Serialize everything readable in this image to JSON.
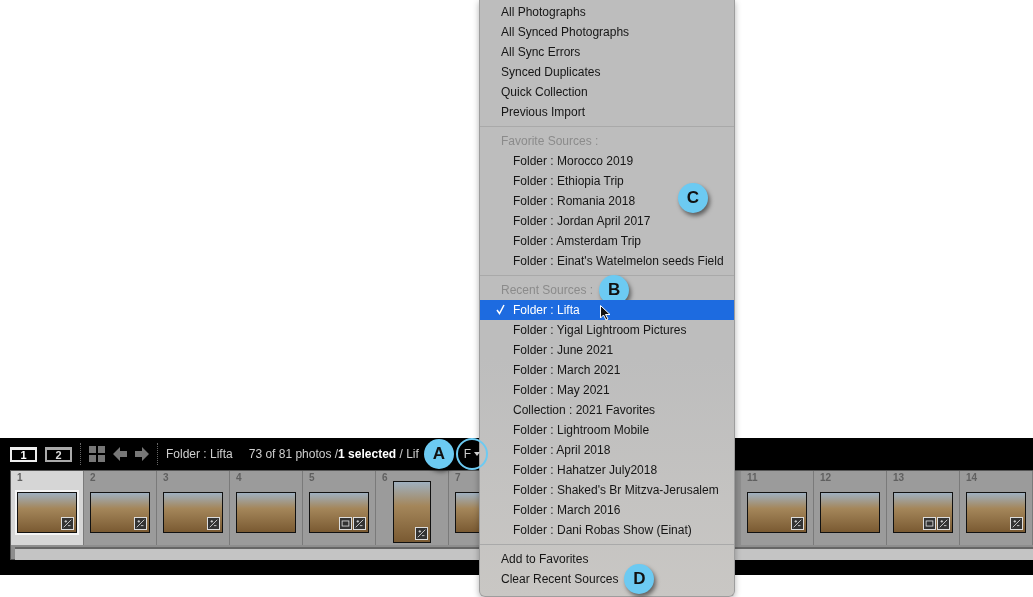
{
  "filmstrip": {
    "toolbar": {
      "screens": [
        {
          "label": "1",
          "selected": true
        },
        {
          "label": "2",
          "selected": false
        }
      ],
      "source": "Folder : Lifta",
      "stats": "73 of 81 photos /**1 selected** / Lif",
      "callout": "A",
      "filter": "F"
    },
    "cell_groups": [
      [
        {
          "number": "1",
          "selected": true,
          "kind": "landscape",
          "edited": true
        },
        {
          "number": "2",
          "selected": false,
          "kind": "landscape",
          "edited": true
        },
        {
          "number": "3",
          "selected": false,
          "kind": "landscape",
          "edited": true
        },
        {
          "number": "4",
          "selected": false,
          "kind": "landscape"
        },
        {
          "number": "5",
          "selected": false,
          "kind": "landscape",
          "cropped": true,
          "edited": true
        },
        {
          "number": "6",
          "selected": false,
          "kind": "portrait",
          "edited": true
        },
        {
          "number": "7",
          "selected": false,
          "kind": "landscape"
        }
      ],
      [
        {
          "number": "11",
          "selected": false,
          "kind": "landscape",
          "edited": true
        },
        {
          "number": "12",
          "selected": false,
          "kind": "landscape"
        },
        {
          "number": "13",
          "selected": false,
          "kind": "landscape",
          "cropped": true,
          "edited": true
        },
        {
          "number": "14",
          "selected": false,
          "kind": "landscape",
          "edited": true
        }
      ]
    ]
  },
  "menu": {
    "sections": [
      {
        "items": [
          {
            "label": "All Photographs",
            "selected": false
          },
          {
            "label": "All Synced Photographs",
            "selected": false
          },
          {
            "label": "All Sync Errors",
            "selected": false
          },
          {
            "label": "Synced Duplicates",
            "selected": false
          },
          {
            "label": "Quick Collection",
            "selected": false
          },
          {
            "label": "Previous Import",
            "selected": false
          }
        ]
      },
      {
        "header": "Favorite Sources :",
        "callout": "C",
        "items": [
          {
            "label": "Folder : Morocco 2019",
            "selected": false
          },
          {
            "label": "Folder : Ethiopia Trip",
            "selected": false
          },
          {
            "label": "Folder : Romania 2018",
            "selected": false
          },
          {
            "label": "Folder : Jordan April 2017",
            "selected": false
          },
          {
            "label": "Folder : Amsterdam Trip",
            "selected": false
          },
          {
            "label": "Folder : Einat's Watelmelon seeds Field",
            "selected": false
          }
        ]
      },
      {
        "header": "Recent Sources :",
        "header_callout": "B",
        "items": [
          {
            "label": "Folder : Lifta",
            "selected": true
          },
          {
            "label": "Folder : Yigal Lightroom Pictures",
            "selected": false
          },
          {
            "label": "Folder : June 2021",
            "selected": false
          },
          {
            "label": "Folder : March 2021",
            "selected": false
          },
          {
            "label": "Folder : May 2021",
            "selected": false
          },
          {
            "label": "Collection : 2021 Favorites",
            "selected": false
          },
          {
            "label": "Folder : Lightroom Mobile",
            "selected": false
          },
          {
            "label": "Folder : April 2018",
            "selected": false
          },
          {
            "label": "Folder : Hahatzer July2018",
            "selected": false
          },
          {
            "label": "Folder : Shaked's Br Mitzva-Jerusalem",
            "selected": false
          },
          {
            "label": "Folder : March 2016",
            "selected": false
          },
          {
            "label": "Folder : Dani Robas Show (Einat)",
            "selected": false
          }
        ]
      },
      {
        "items": [
          {
            "label": "Add to Favorites",
            "selected": false
          },
          {
            "label": "Clear Recent Sources",
            "selected": false,
            "callout": "D"
          }
        ]
      }
    ]
  }
}
